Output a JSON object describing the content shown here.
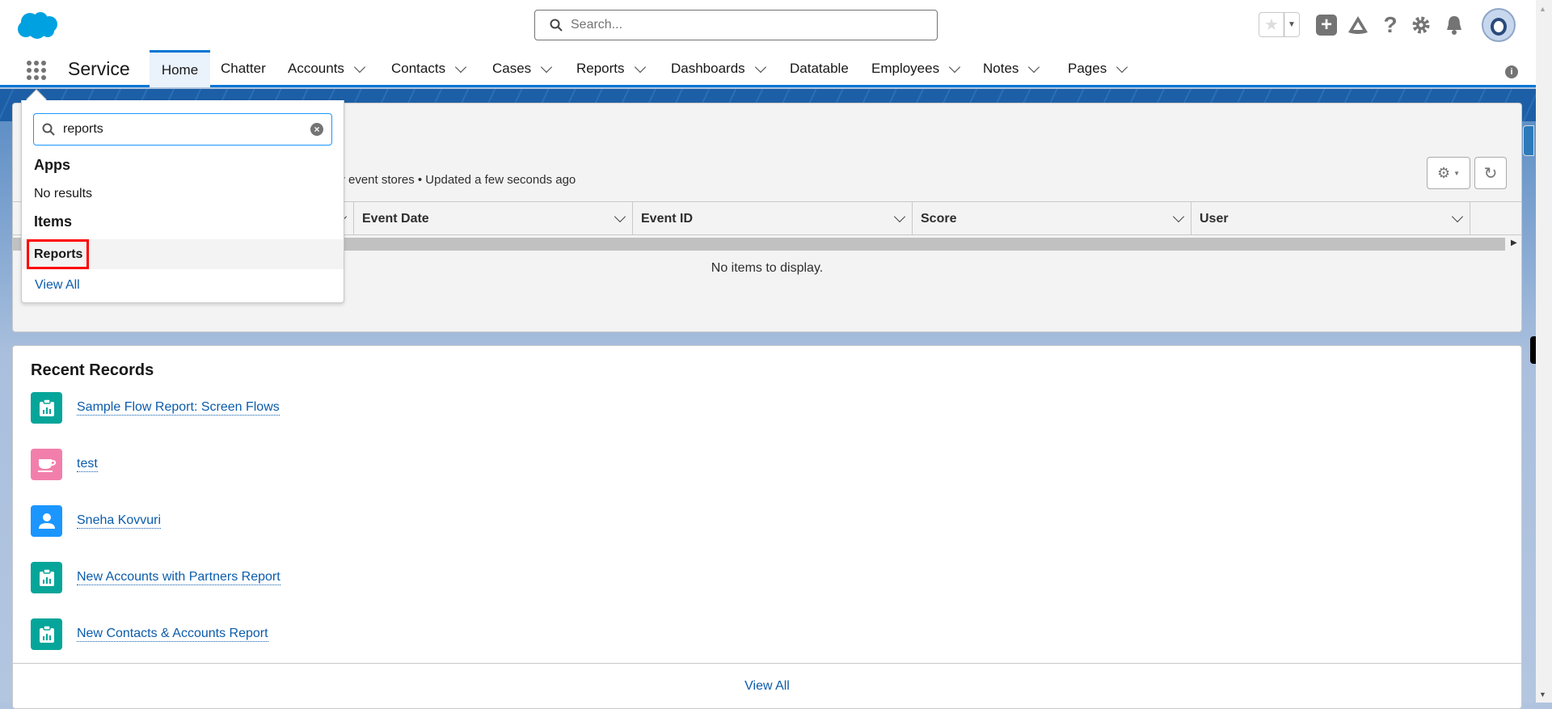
{
  "header": {
    "search_placeholder": "Search...",
    "app_name": "Service"
  },
  "nav": {
    "tabs": [
      {
        "label": "Home",
        "dropdown": false,
        "active": true
      },
      {
        "label": "Chatter",
        "dropdown": false
      },
      {
        "label": "Accounts",
        "dropdown": true
      },
      {
        "label": "Contacts",
        "dropdown": true
      },
      {
        "label": "Cases",
        "dropdown": true
      },
      {
        "label": "Reports",
        "dropdown": true
      },
      {
        "label": "Dashboards",
        "dropdown": true
      },
      {
        "label": "Datatable",
        "dropdown": false
      },
      {
        "label": "Employees",
        "dropdown": true
      },
      {
        "label": "Notes",
        "dropdown": true
      },
      {
        "label": "Pages",
        "dropdown": true
      }
    ]
  },
  "launcher": {
    "query": "reports",
    "apps_heading": "Apps",
    "apps_empty": "No results",
    "items_heading": "Items",
    "items": [
      "Reports"
    ],
    "view_all": "View All"
  },
  "event_card": {
    "subtitle": "ly event stores • Updated a few seconds ago",
    "columns": [
      "Event Date",
      "Event ID",
      "Score",
      "User"
    ],
    "empty": "No items to display."
  },
  "recent": {
    "title": "Recent Records",
    "items": [
      {
        "label": "Sample Flow Report: Screen Flows",
        "icon": "report-icon",
        "color": "#06a59a"
      },
      {
        "label": "test",
        "icon": "cup-icon",
        "color": "#f27fab"
      },
      {
        "label": "Sneha Kovvuri",
        "icon": "contact-icon",
        "color": "#1b96ff"
      },
      {
        "label": "New Accounts with Partners Report",
        "icon": "report-icon",
        "color": "#06a59a"
      },
      {
        "label": "New Contacts & Accounts Report",
        "icon": "report-icon",
        "color": "#06a59a"
      }
    ],
    "view_all": "View All"
  },
  "colors": {
    "brand": "#0176d3",
    "link": "#0b5cab",
    "highlight": "#ff0000"
  }
}
